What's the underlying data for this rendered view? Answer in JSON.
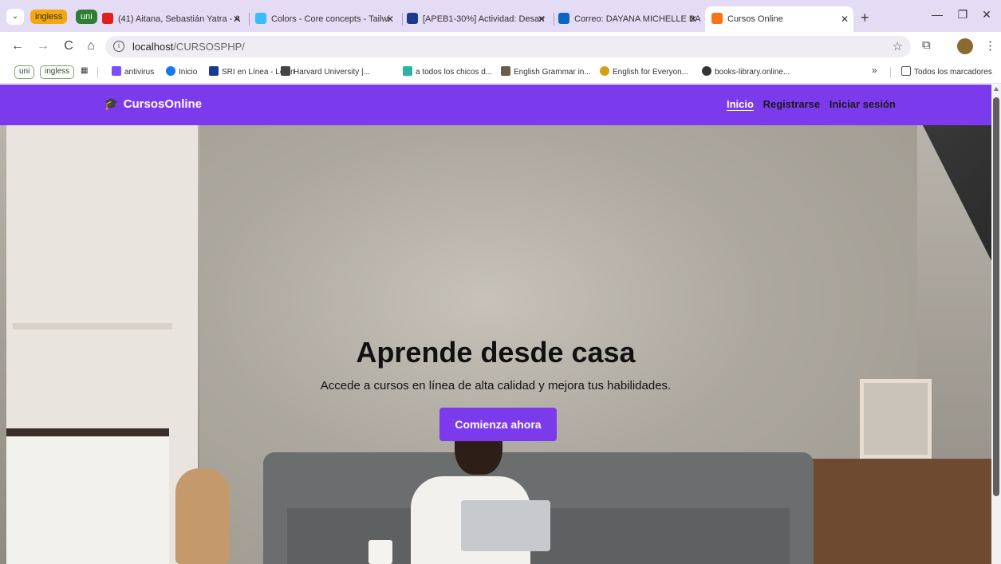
{
  "browser": {
    "tab_groups": [
      "ingless",
      "uni"
    ],
    "tabs": [
      {
        "title": "(41) Aitana, Sebastián Yatra - A",
        "favicon_color": "#e02020"
      },
      {
        "title": "Colors - Core concepts - Tailwi",
        "favicon_color": "#38bdf8"
      },
      {
        "title": "[APEB1-30%] Actividad: Desarr",
        "favicon_color": "#1e3a8a"
      },
      {
        "title": "Correo: DAYANA MICHELLE BA",
        "favicon_color": "#0a66c2"
      },
      {
        "title": "Cursos Online",
        "favicon_color": "#f97316",
        "active": true
      }
    ],
    "new_tab_label": "+",
    "window_controls": [
      "—",
      "❐",
      "✕"
    ],
    "nav": {
      "back": "←",
      "forward": "→",
      "reload": "C",
      "home": "⌂"
    },
    "address": {
      "host": "localhost",
      "path": "/CURSOSPHP/"
    },
    "bookmark_chips": [
      "uni",
      "ingless"
    ],
    "bookmarks": [
      "antivirus",
      "Inicio",
      "SRI en Línea - Login",
      "Harvard University |...",
      "a todos los chicos d...",
      "English Grammar in...",
      "English for Everyon...",
      "books-library.online..."
    ],
    "bookmarks_overflow": "»",
    "all_bookmarks": "Todos los marcadores"
  },
  "site": {
    "brand": "CursosOnline",
    "nav_links": [
      "Inicio",
      "Registrarse",
      "Iniciar sesión"
    ],
    "active_link": "Inicio",
    "accent_color": "#7c3aed",
    "hero": {
      "title": "Aprende desde casa",
      "subtitle": "Accede a cursos en línea de alta calidad y mejora tus habilidades.",
      "cta_label": "Comienza ahora"
    }
  }
}
